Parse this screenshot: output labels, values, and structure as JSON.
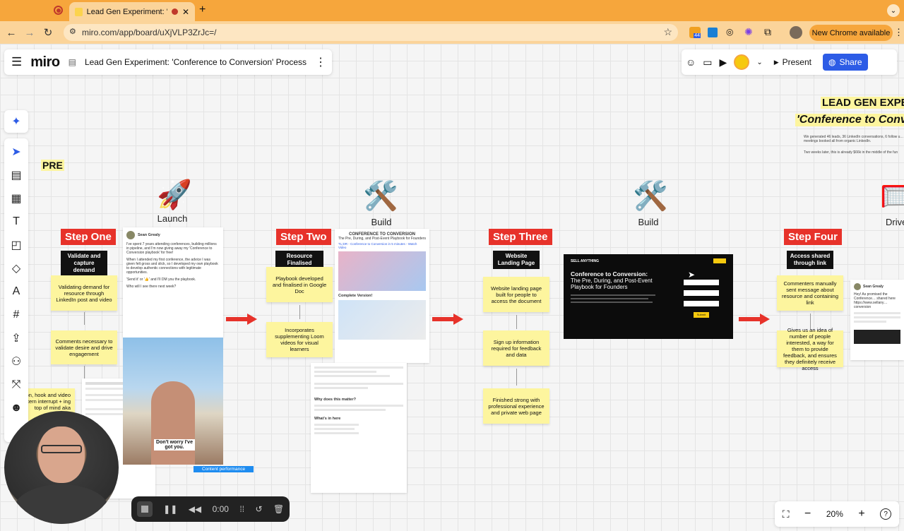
{
  "browser": {
    "tab_title": "Lead Gen Experiment: 'Co",
    "url": "miro.com/app/board/uXjVLP3ZrJc=/",
    "extension_badge": "44",
    "new_chrome": "New Chrome available"
  },
  "miro": {
    "logo": "miro",
    "board_title": "Lead Gen Experiment: 'Conference to Conversion' Process",
    "present_label": "Present",
    "share_label": "Share",
    "zoom": "20%"
  },
  "board": {
    "pre_label": "PRE",
    "header_title": "LEAD GEN EXPER",
    "header_subtitle": "'Conference to Convers",
    "header_text1": "We generated 46 leads, 36 LinkedIn conversations, 6 follow u… meetings booked all from organic LinkedIn.",
    "header_text2": "Two weeks later, this is already $66k in the middle of the fun",
    "stages": [
      {
        "icon": "🚀",
        "label": "Launch"
      },
      {
        "icon": "🛠️",
        "label": "Build"
      },
      {
        "icon": "🛠️",
        "label": "Build"
      },
      {
        "icon": "🥅",
        "label": "Drive"
      }
    ],
    "step1": {
      "badge": "Step One",
      "label": "Validate and capture demand",
      "sticky1": "Validating demand for resource through LinkedIn post and video",
      "sticky2": "Comments necessary to validate desire and drive engagement",
      "sticky3": "on, hook and video attern interrupt + ing top of mind aka valiz"
    },
    "step2": {
      "badge": "Step Two",
      "label": "Resource Finalised",
      "sticky1": "Playbook developed and finalised in Google Doc",
      "sticky2": "Incorporates supplementing Loom videos for visual learners"
    },
    "step3": {
      "badge": "Step Three",
      "label": "Website Landing Page",
      "sticky1": "Website landing page built for people to access the document",
      "sticky2": "Sign up information required for feedback and data",
      "sticky3": "Finished strong with professional experience and private web page"
    },
    "step4": {
      "badge": "Step Four",
      "label": "Access shared through link",
      "sticky1": "Commenters manually sent message about resource and containing link",
      "sticky2": "Gives us an idea of number of people interested, a way for them to provide feedback, and ensures they definitely receive access"
    },
    "linkedin_post": {
      "author": "Sean Grealy",
      "line1": "I've spent 7 years attending conferences, building millions in pipeline, and I'm now giving away my 'Conference to Conversion playbook' for free!",
      "line2": "When I attended my first conference, the advice I was given felt gross and slick, so I developed my own playbook to develop authentic connections with legitimate opportunities.",
      "line3": "'Send it' or '👍' and I'll DM you the playbook.",
      "line4": "Who will I see there next week?",
      "video_caption": "Don't worry I've got you.",
      "perf_label": "Content performance"
    },
    "doc": {
      "title": "CONFERENCE TO CONVERSION",
      "subtitle": "The Pre, During, and Post-Event Playbook for Founders",
      "loom": "TL;DR - Conference to Conversion in 5 minutes - Watch Video",
      "complete": "Complete Version!",
      "why": "Why does this matter?",
      "whats_here": "What's in here"
    },
    "landing": {
      "brand": "SELL ANYTHING",
      "headline": "Conference to Conversion:",
      "subhead": "The Pre, During, and Post-Event Playbook for Founders",
      "cta": "Submit"
    },
    "dm": {
      "author": "Sean Grealy",
      "text": "Hey! As promised the Conference… shared here https://www.sellany… conversion"
    }
  },
  "recorder": {
    "time": "0:00"
  },
  "colors": {
    "accent": "#2d5ce6",
    "step_red": "#e7322a",
    "sticky": "#fdf59e",
    "chrome_orange": "#f6a63c"
  }
}
